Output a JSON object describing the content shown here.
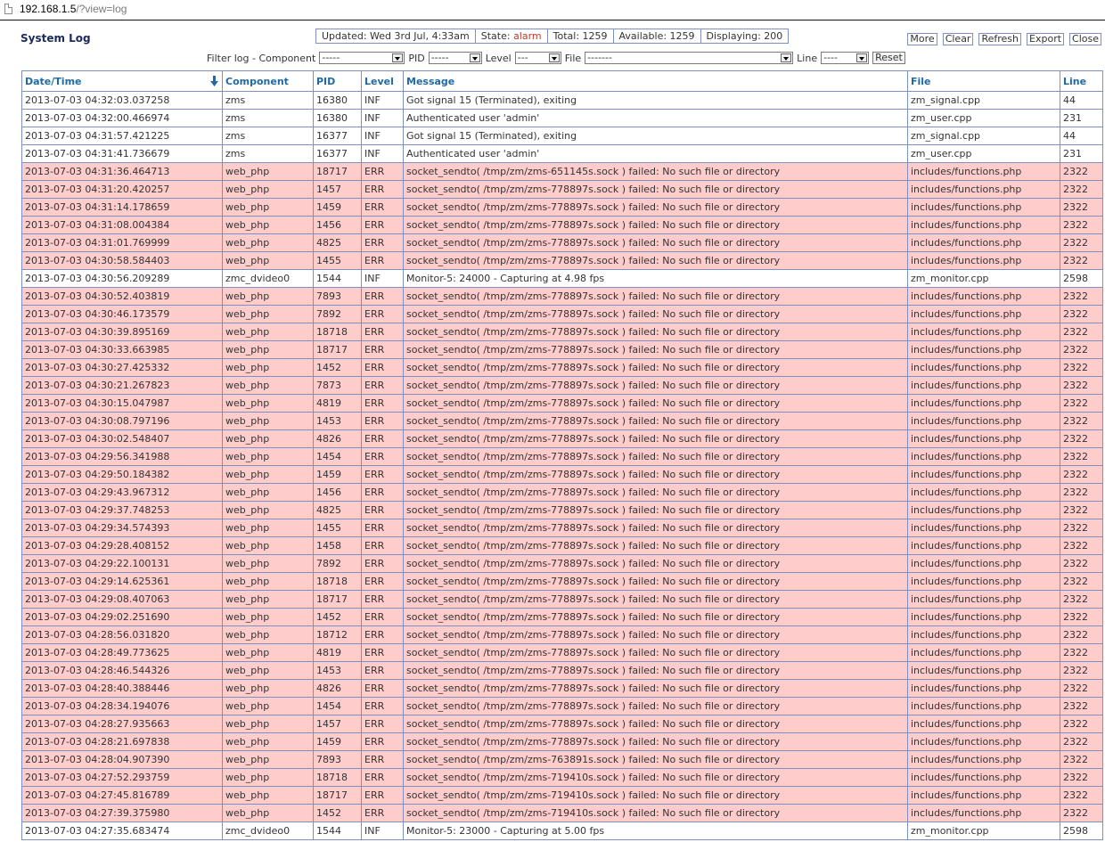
{
  "browser": {
    "url_host": "192.168.1.5",
    "url_path": "/?view=log"
  },
  "page": {
    "title": "System Log"
  },
  "status": {
    "updated": "Updated: Wed 3rd Jul, 4:33am",
    "state_label": "State:",
    "state_value": "alarm",
    "total": "Total: 1259",
    "available": "Available: 1259",
    "displaying": "Displaying: 200"
  },
  "actions": {
    "more": "More",
    "clear": "Clear",
    "refresh": "Refresh",
    "export": "Export",
    "close": "Close"
  },
  "filter": {
    "label": "Filter log - Component",
    "component_value": "-----",
    "pid_label": "PID",
    "pid_value": "-----",
    "level_label": "Level",
    "level_value": "---",
    "file_label": "File",
    "file_value": "-------",
    "line_label": "Line",
    "line_value": "----",
    "reset": "Reset"
  },
  "colors": {
    "inf_row": "#ffffff",
    "err_row": "#ffcccc",
    "header_text": "#1f6aa5",
    "border": "#7f8fbf",
    "alarm": "#c0392b"
  },
  "table": {
    "headers": {
      "datetime": "Date/Time",
      "component": "Component",
      "pid": "PID",
      "level": "Level",
      "message": "Message",
      "file": "File",
      "line": "Line"
    },
    "sort_icon": "sort-down-arrow-icon",
    "rows": [
      [
        "2013-07-03 04:32:03.037258",
        "zms",
        "16380",
        "INF",
        "Got signal 15 (Terminated), exiting",
        "zm_signal.cpp",
        "44"
      ],
      [
        "2013-07-03 04:32:00.466974",
        "zms",
        "16380",
        "INF",
        "Authenticated user 'admin'",
        "zm_user.cpp",
        "231"
      ],
      [
        "2013-07-03 04:31:57.421225",
        "zms",
        "16377",
        "INF",
        "Got signal 15 (Terminated), exiting",
        "zm_signal.cpp",
        "44"
      ],
      [
        "2013-07-03 04:31:41.736679",
        "zms",
        "16377",
        "INF",
        "Authenticated user 'admin'",
        "zm_user.cpp",
        "231"
      ],
      [
        "2013-07-03 04:31:36.464713",
        "web_php",
        "18717",
        "ERR",
        "socket_sendto( /tmp/zm/zms-651145s.sock ) failed: No such file or directory",
        "includes/functions.php",
        "2322"
      ],
      [
        "2013-07-03 04:31:20.420257",
        "web_php",
        "1457",
        "ERR",
        "socket_sendto( /tmp/zm/zms-778897s.sock ) failed: No such file or directory",
        "includes/functions.php",
        "2322"
      ],
      [
        "2013-07-03 04:31:14.178659",
        "web_php",
        "1459",
        "ERR",
        "socket_sendto( /tmp/zm/zms-778897s.sock ) failed: No such file or directory",
        "includes/functions.php",
        "2322"
      ],
      [
        "2013-07-03 04:31:08.004384",
        "web_php",
        "1456",
        "ERR",
        "socket_sendto( /tmp/zm/zms-778897s.sock ) failed: No such file or directory",
        "includes/functions.php",
        "2322"
      ],
      [
        "2013-07-03 04:31:01.769999",
        "web_php",
        "4825",
        "ERR",
        "socket_sendto( /tmp/zm/zms-778897s.sock ) failed: No such file or directory",
        "includes/functions.php",
        "2322"
      ],
      [
        "2013-07-03 04:30:58.584403",
        "web_php",
        "1455",
        "ERR",
        "socket_sendto( /tmp/zm/zms-778897s.sock ) failed: No such file or directory",
        "includes/functions.php",
        "2322"
      ],
      [
        "2013-07-03 04:30:56.209289",
        "zmc_dvideo0",
        "1544",
        "INF",
        "Monitor-5: 24000 - Capturing at 4.98 fps",
        "zm_monitor.cpp",
        "2598"
      ],
      [
        "2013-07-03 04:30:52.403819",
        "web_php",
        "7893",
        "ERR",
        "socket_sendto( /tmp/zm/zms-778897s.sock ) failed: No such file or directory",
        "includes/functions.php",
        "2322"
      ],
      [
        "2013-07-03 04:30:46.173579",
        "web_php",
        "7892",
        "ERR",
        "socket_sendto( /tmp/zm/zms-778897s.sock ) failed: No such file or directory",
        "includes/functions.php",
        "2322"
      ],
      [
        "2013-07-03 04:30:39.895169",
        "web_php",
        "18718",
        "ERR",
        "socket_sendto( /tmp/zm/zms-778897s.sock ) failed: No such file or directory",
        "includes/functions.php",
        "2322"
      ],
      [
        "2013-07-03 04:30:33.663985",
        "web_php",
        "18717",
        "ERR",
        "socket_sendto( /tmp/zm/zms-778897s.sock ) failed: No such file or directory",
        "includes/functions.php",
        "2322"
      ],
      [
        "2013-07-03 04:30:27.425332",
        "web_php",
        "1452",
        "ERR",
        "socket_sendto( /tmp/zm/zms-778897s.sock ) failed: No such file or directory",
        "includes/functions.php",
        "2322"
      ],
      [
        "2013-07-03 04:30:21.267823",
        "web_php",
        "7873",
        "ERR",
        "socket_sendto( /tmp/zm/zms-778897s.sock ) failed: No such file or directory",
        "includes/functions.php",
        "2322"
      ],
      [
        "2013-07-03 04:30:15.047987",
        "web_php",
        "4819",
        "ERR",
        "socket_sendto( /tmp/zm/zms-778897s.sock ) failed: No such file or directory",
        "includes/functions.php",
        "2322"
      ],
      [
        "2013-07-03 04:30:08.797196",
        "web_php",
        "1453",
        "ERR",
        "socket_sendto( /tmp/zm/zms-778897s.sock ) failed: No such file or directory",
        "includes/functions.php",
        "2322"
      ],
      [
        "2013-07-03 04:30:02.548407",
        "web_php",
        "4826",
        "ERR",
        "socket_sendto( /tmp/zm/zms-778897s.sock ) failed: No such file or directory",
        "includes/functions.php",
        "2322"
      ],
      [
        "2013-07-03 04:29:56.341988",
        "web_php",
        "1454",
        "ERR",
        "socket_sendto( /tmp/zm/zms-778897s.sock ) failed: No such file or directory",
        "includes/functions.php",
        "2322"
      ],
      [
        "2013-07-03 04:29:50.184382",
        "web_php",
        "1459",
        "ERR",
        "socket_sendto( /tmp/zm/zms-778897s.sock ) failed: No such file or directory",
        "includes/functions.php",
        "2322"
      ],
      [
        "2013-07-03 04:29:43.967312",
        "web_php",
        "1456",
        "ERR",
        "socket_sendto( /tmp/zm/zms-778897s.sock ) failed: No such file or directory",
        "includes/functions.php",
        "2322"
      ],
      [
        "2013-07-03 04:29:37.748253",
        "web_php",
        "4825",
        "ERR",
        "socket_sendto( /tmp/zm/zms-778897s.sock ) failed: No such file or directory",
        "includes/functions.php",
        "2322"
      ],
      [
        "2013-07-03 04:29:34.574393",
        "web_php",
        "1455",
        "ERR",
        "socket_sendto( /tmp/zm/zms-778897s.sock ) failed: No such file or directory",
        "includes/functions.php",
        "2322"
      ],
      [
        "2013-07-03 04:29:28.408152",
        "web_php",
        "1458",
        "ERR",
        "socket_sendto( /tmp/zm/zms-778897s.sock ) failed: No such file or directory",
        "includes/functions.php",
        "2322"
      ],
      [
        "2013-07-03 04:29:22.100131",
        "web_php",
        "7892",
        "ERR",
        "socket_sendto( /tmp/zm/zms-778897s.sock ) failed: No such file or directory",
        "includes/functions.php",
        "2322"
      ],
      [
        "2013-07-03 04:29:14.625361",
        "web_php",
        "18718",
        "ERR",
        "socket_sendto( /tmp/zm/zms-778897s.sock ) failed: No such file or directory",
        "includes/functions.php",
        "2322"
      ],
      [
        "2013-07-03 04:29:08.407063",
        "web_php",
        "18717",
        "ERR",
        "socket_sendto( /tmp/zm/zms-778897s.sock ) failed: No such file or directory",
        "includes/functions.php",
        "2322"
      ],
      [
        "2013-07-03 04:29:02.251690",
        "web_php",
        "1452",
        "ERR",
        "socket_sendto( /tmp/zm/zms-778897s.sock ) failed: No such file or directory",
        "includes/functions.php",
        "2322"
      ],
      [
        "2013-07-03 04:28:56.031820",
        "web_php",
        "18712",
        "ERR",
        "socket_sendto( /tmp/zm/zms-778897s.sock ) failed: No such file or directory",
        "includes/functions.php",
        "2322"
      ],
      [
        "2013-07-03 04:28:49.773625",
        "web_php",
        "4819",
        "ERR",
        "socket_sendto( /tmp/zm/zms-778897s.sock ) failed: No such file or directory",
        "includes/functions.php",
        "2322"
      ],
      [
        "2013-07-03 04:28:46.544326",
        "web_php",
        "1453",
        "ERR",
        "socket_sendto( /tmp/zm/zms-778897s.sock ) failed: No such file or directory",
        "includes/functions.php",
        "2322"
      ],
      [
        "2013-07-03 04:28:40.388446",
        "web_php",
        "4826",
        "ERR",
        "socket_sendto( /tmp/zm/zms-778897s.sock ) failed: No such file or directory",
        "includes/functions.php",
        "2322"
      ],
      [
        "2013-07-03 04:28:34.194076",
        "web_php",
        "1454",
        "ERR",
        "socket_sendto( /tmp/zm/zms-778897s.sock ) failed: No such file or directory",
        "includes/functions.php",
        "2322"
      ],
      [
        "2013-07-03 04:28:27.935663",
        "web_php",
        "1457",
        "ERR",
        "socket_sendto( /tmp/zm/zms-778897s.sock ) failed: No such file or directory",
        "includes/functions.php",
        "2322"
      ],
      [
        "2013-07-03 04:28:21.697838",
        "web_php",
        "1459",
        "ERR",
        "socket_sendto( /tmp/zm/zms-778897s.sock ) failed: No such file or directory",
        "includes/functions.php",
        "2322"
      ],
      [
        "2013-07-03 04:28:04.907390",
        "web_php",
        "7893",
        "ERR",
        "socket_sendto( /tmp/zm/zms-763891s.sock ) failed: No such file or directory",
        "includes/functions.php",
        "2322"
      ],
      [
        "2013-07-03 04:27:52.293759",
        "web_php",
        "18718",
        "ERR",
        "socket_sendto( /tmp/zm/zms-719410s.sock ) failed: No such file or directory",
        "includes/functions.php",
        "2322"
      ],
      [
        "2013-07-03 04:27:45.816789",
        "web_php",
        "18717",
        "ERR",
        "socket_sendto( /tmp/zm/zms-719410s.sock ) failed: No such file or directory",
        "includes/functions.php",
        "2322"
      ],
      [
        "2013-07-03 04:27:39.375980",
        "web_php",
        "1452",
        "ERR",
        "socket_sendto( /tmp/zm/zms-719410s.sock ) failed: No such file or directory",
        "includes/functions.php",
        "2322"
      ],
      [
        "2013-07-03 04:27:35.683474",
        "zmc_dvideo0",
        "1544",
        "INF",
        "Monitor-5: 23000 - Capturing at 5.00 fps",
        "zm_monitor.cpp",
        "2598"
      ]
    ]
  }
}
